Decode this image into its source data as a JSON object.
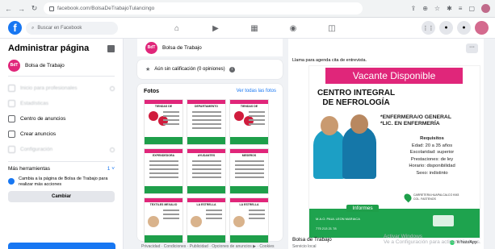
{
  "browser": {
    "back_icon": "arrow-left-icon",
    "url": "facebook.com/BolsaDeTrabajoTulancingo"
  },
  "fb": {
    "search_placeholder": "Buscar en Facebook"
  },
  "sidebar": {
    "title": "Administrar página",
    "page_name": "Bolsa de Trabajo",
    "page_avatar_text": "BdT",
    "items": [
      {
        "label": "Inicio para profesionales",
        "blurred": true
      },
      {
        "label": "Estadísticas",
        "blurred": true
      },
      {
        "label": "Centro de anuncios",
        "blurred": false
      },
      {
        "label": "Crear anuncios",
        "blurred": false
      },
      {
        "label": "Configuración",
        "blurred": true
      }
    ],
    "tools_label": "Más herramientas",
    "tools_count": "1",
    "switch_text": "Cambia a la página de Bolsa de Trabajo para realizar más acciones",
    "change_button": "Cambiar"
  },
  "center": {
    "page_name": "Bolsa de Trabajo",
    "rating_text": "Aún sin calificación (0 opiniones)",
    "photos_title": "Fotos",
    "photos_link": "Ver todas las fotos",
    "thumbs": [
      {
        "title": "TIENDAS DE",
        "type": "bb"
      },
      {
        "title": "DEPARTAMENTO",
        "type": "lines"
      },
      {
        "title": "TIENDAS DE",
        "type": "bb"
      },
      {
        "title": "EXPENDEDORA",
        "type": "lines"
      },
      {
        "title": "AYUDANTES",
        "type": "lines"
      },
      {
        "title": "MESEROS",
        "type": "lines"
      },
      {
        "title": "TEXTILES MEXALIO",
        "type": "face"
      },
      {
        "title": "LA ESTRELLA",
        "type": "face"
      },
      {
        "title": "LA ESTRELLA",
        "type": "face"
      }
    ],
    "footer": "Privacidad · Condiciones · Publicidad · Opciones de anuncios ▶ · Cookies"
  },
  "post": {
    "caption": "Llama para agenda cita de entrevista.",
    "flyer": {
      "header": "Vacante Disponible",
      "clinic": "CENTRO INTEGRAL DE NEFROLOGÍA",
      "role1": "*ENFERMERA/O GENERAL",
      "role2": "*LIC. EN ENFERMERÍA",
      "req_title": "Requisitos",
      "requirements": [
        "Edad: 20 a 35 años",
        "Escolaridad: superior",
        "Prestaciones: de ley",
        "Horario: disponibilidad",
        "Sexo: indistinto"
      ],
      "address": "CARRETERA HUAPALCALCO KM3 COL. FASTENOS",
      "info_tab": "Informes",
      "info_name": "M.A.O. PAUL LEON MARIACA",
      "info_phone": "775 213 21 78"
    },
    "page_name": "Bolsa de Trabajo",
    "page_sub": "Servicio local",
    "whatsapp": "WhatsApp"
  },
  "watermark": {
    "line1": "Activar Windows",
    "line2": "Ve a Configuración para activar Windows."
  },
  "colors": {
    "fb_blue": "#1877f2",
    "flyer_pink": "#e0267a",
    "flyer_green": "#1ea34e"
  }
}
